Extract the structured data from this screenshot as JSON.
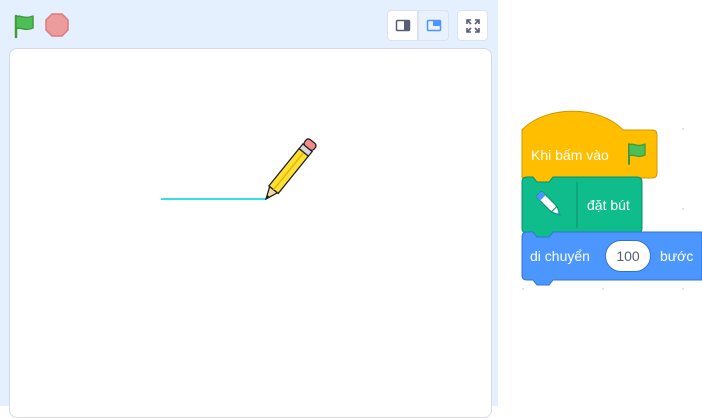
{
  "stage_toolbar": {
    "green_flag": "green-flag-icon",
    "stop": "stop-icon",
    "small_stage": "small-stage-icon",
    "normal_stage": "normal-stage-icon",
    "fullscreen": "fullscreen-icon"
  },
  "stage": {
    "sprite": "pencil-sprite",
    "pen_line_color": "#33e0e8"
  },
  "script": {
    "hat_block": {
      "label": "Khi bấm vào",
      "icon": "green-flag-icon",
      "color": "#ffbf00"
    },
    "pen_block": {
      "label": "đặt bút",
      "icon": "pen-icon",
      "color": "#0fbd8c"
    },
    "move_block": {
      "label_before": "di chuyển",
      "steps": "100",
      "label_after": "bước",
      "color": "#4c97ff"
    }
  }
}
